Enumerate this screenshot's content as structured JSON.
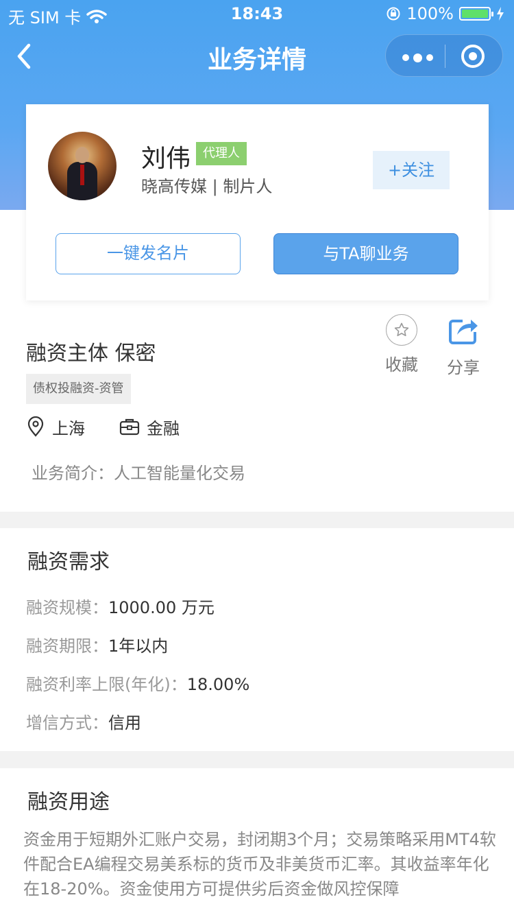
{
  "status_bar": {
    "carrier": "无 SIM 卡",
    "time": "18:43",
    "battery_percent": "100%"
  },
  "nav": {
    "title": "业务详情"
  },
  "profile": {
    "name": "刘伟",
    "badge": "代理人",
    "subtitle": "晓高传媒 | 制片人",
    "follow": "+关注",
    "send_card": "一键发名片",
    "chat": "与TA聊业务"
  },
  "business": {
    "title": "融资主体 保密",
    "tag": "债权投融资-资管",
    "favorite": "收藏",
    "share": "分享",
    "location": "上海",
    "industry": "金融",
    "intro": "业务简介：人工智能量化交易"
  },
  "demand": {
    "title": "融资需求",
    "rows": [
      {
        "label": "融资规模：",
        "value": "1000.00 万元"
      },
      {
        "label": "融资期限：",
        "value": "1年以内"
      },
      {
        "label": "融资利率上限(年化)：",
        "value": "18.00%"
      },
      {
        "label": "增信方式：",
        "value": "信用"
      }
    ]
  },
  "usage": {
    "title": "融资用途",
    "text": "资金用于短期外汇账户交易，封闭期3个月；交易策略采用MT4软件配合EA编程交易美系标的货币及非美货币汇率。其收益率年化在18-20%。资金使用方可提供劣后资金做风控保障"
  },
  "colors": {
    "header_blue": "#4aa3f0",
    "accent_blue": "#5aa3eb",
    "badge_green": "#8ccf6f",
    "battery_green": "#5fe06a"
  }
}
